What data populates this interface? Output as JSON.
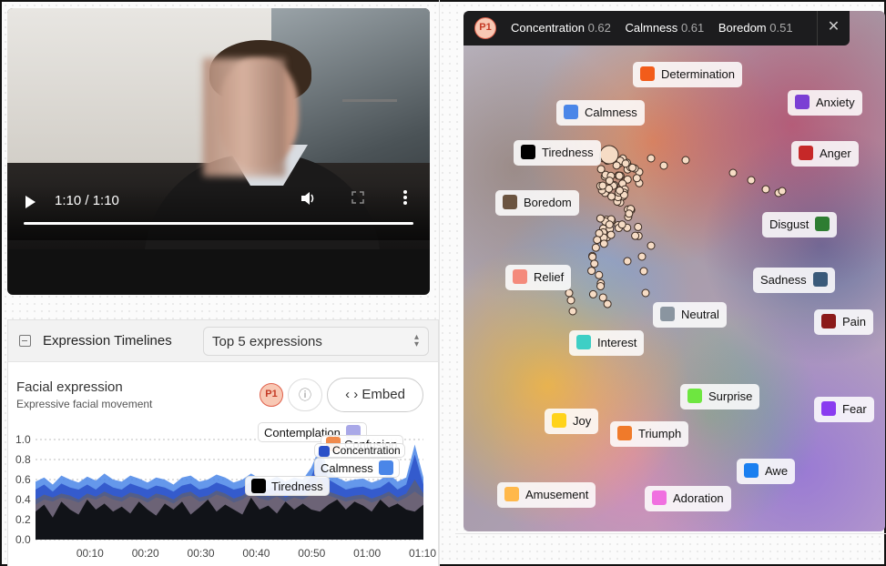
{
  "video": {
    "time": "1:10 / 1:10",
    "progress_fraction": 1.0,
    "icons": {
      "play": "play-icon",
      "volume": "volume-icon",
      "fullscreen": "fullscreen-icon",
      "more": "more-vertical-icon"
    }
  },
  "timelines": {
    "title": "Expression Timelines",
    "select_value": "Top 5 expressions",
    "section_title": "Facial expression",
    "section_subtitle": "Expressive facial movement",
    "participant": "P1",
    "embed_label": "Embed",
    "embed_icon": "‹ ›",
    "info_icon": "ⓘ"
  },
  "chart_data": {
    "type": "area",
    "x_ticks": [
      "00:10",
      "00:20",
      "00:30",
      "00:40",
      "00:50",
      "01:00",
      "01:10"
    ],
    "y_ticks": [
      "0.0",
      "0.2",
      "0.4",
      "0.6",
      "0.8",
      "1.0"
    ],
    "ylim": [
      0,
      1.0
    ],
    "xlim_seconds": [
      0,
      70
    ],
    "legend_position": "top-right-overlay",
    "series": [
      {
        "name": "Calmness",
        "color": "#4a86e8",
        "values": [
          0.58,
          0.62,
          0.55,
          0.64,
          0.6,
          0.57,
          0.63,
          0.59,
          0.66,
          0.6,
          0.58,
          0.64,
          0.61,
          0.57,
          0.62,
          0.6,
          0.55,
          0.62,
          0.64,
          0.58,
          0.6,
          0.65,
          0.62,
          0.57,
          0.6,
          0.66,
          0.61,
          0.59,
          0.63,
          0.58,
          0.62,
          0.6,
          0.72,
          0.93,
          0.68,
          0.62,
          0.58,
          0.6,
          0.61,
          0.57,
          0.6,
          0.66,
          0.58,
          0.62,
          0.95,
          0.62
        ]
      },
      {
        "name": "Concentration",
        "color": "#2b50c8",
        "values": [
          0.5,
          0.55,
          0.48,
          0.56,
          0.52,
          0.5,
          0.55,
          0.5,
          0.57,
          0.52,
          0.5,
          0.56,
          0.53,
          0.5,
          0.54,
          0.52,
          0.48,
          0.54,
          0.56,
          0.5,
          0.52,
          0.57,
          0.54,
          0.5,
          0.52,
          0.58,
          0.53,
          0.5,
          0.55,
          0.5,
          0.54,
          0.52,
          0.63,
          0.85,
          0.6,
          0.55,
          0.5,
          0.52,
          0.53,
          0.5,
          0.52,
          0.58,
          0.5,
          0.55,
          0.85,
          0.55
        ]
      },
      {
        "name": "Confusion",
        "color": "#e8834a",
        "values": [
          0.35,
          0.4,
          0.38,
          0.42,
          0.4,
          0.37,
          0.42,
          0.4,
          0.44,
          0.4,
          0.38,
          0.43,
          0.41,
          0.37,
          0.42,
          0.4,
          0.36,
          0.42,
          0.44,
          0.38,
          0.4,
          0.45,
          0.42,
          0.37,
          0.4,
          0.46,
          0.41,
          0.39,
          0.43,
          0.38,
          0.42,
          0.4,
          0.45,
          0.5,
          0.44,
          0.41,
          0.38,
          0.4,
          0.41,
          0.37,
          0.4,
          0.44,
          0.38,
          0.42,
          0.48,
          0.42
        ]
      },
      {
        "name": "Contemplation",
        "color": "#5a5f7a",
        "values": [
          0.4,
          0.45,
          0.42,
          0.46,
          0.44,
          0.4,
          0.46,
          0.43,
          0.48,
          0.44,
          0.42,
          0.47,
          0.45,
          0.41,
          0.46,
          0.44,
          0.4,
          0.46,
          0.48,
          0.42,
          0.44,
          0.49,
          0.46,
          0.41,
          0.44,
          0.5,
          0.45,
          0.43,
          0.47,
          0.42,
          0.46,
          0.44,
          0.5,
          0.62,
          0.48,
          0.45,
          0.42,
          0.44,
          0.45,
          0.41,
          0.44,
          0.48,
          0.42,
          0.46,
          0.6,
          0.46
        ]
      },
      {
        "name": "Tiredness",
        "color": "#111318",
        "values": [
          0.28,
          0.35,
          0.22,
          0.38,
          0.3,
          0.25,
          0.4,
          0.3,
          0.36,
          0.28,
          0.33,
          0.26,
          0.38,
          0.3,
          0.24,
          0.36,
          0.3,
          0.38,
          0.25,
          0.32,
          0.4,
          0.28,
          0.35,
          0.3,
          0.25,
          0.42,
          0.3,
          0.34,
          0.26,
          0.38,
          0.3,
          0.36,
          0.3,
          0.28,
          0.35,
          0.4,
          0.3,
          0.38,
          0.34,
          0.28,
          0.4,
          0.32,
          0.36,
          0.3,
          0.28,
          0.35
        ]
      }
    ]
  },
  "chart_legend": {
    "contemplation": {
      "label": "Contemplation",
      "color": "#a9a8e8"
    },
    "confusion": {
      "label": "Confusion",
      "color": "#f08a4b"
    },
    "concentration": {
      "label": "Concentration",
      "color": "#2b50c8"
    },
    "calmness": {
      "label": "Calmness",
      "color": "#4a86e8"
    },
    "tiredness": {
      "label": "Tiredness",
      "color": "#000000"
    }
  },
  "map": {
    "participant": "P1",
    "stats": [
      {
        "name": "Concentration",
        "value": "0.62"
      },
      {
        "name": "Calmness",
        "value": "0.61"
      },
      {
        "name": "Boredom",
        "value": "0.51"
      }
    ],
    "close_icon": "✕",
    "labels": {
      "determination": {
        "label": "Determination",
        "color": "#f25c1a"
      },
      "anxiety": {
        "label": "Anxiety",
        "color": "#7b3fd4"
      },
      "calmness": {
        "label": "Calmness",
        "color": "#4a86e8"
      },
      "anger": {
        "label": "Anger",
        "color": "#c62828"
      },
      "tiredness": {
        "label": "Tiredness",
        "color": "#000000"
      },
      "boredom": {
        "label": "Boredom",
        "color": "#6b5440"
      },
      "disgust": {
        "label": "Disgust",
        "color": "#2e7d32"
      },
      "relief": {
        "label": "Relief",
        "color": "#f48a7c"
      },
      "sadness": {
        "label": "Sadness",
        "color": "#3a5a7a"
      },
      "neutral": {
        "label": "Neutral",
        "color": "#8a95a0"
      },
      "pain": {
        "label": "Pain",
        "color": "#8b1a1a"
      },
      "interest": {
        "label": "Interest",
        "color": "#3ecfc5"
      },
      "surprise": {
        "label": "Surprise",
        "color": "#6ee640"
      },
      "fear": {
        "label": "Fear",
        "color": "#8a3cf0"
      },
      "joy": {
        "label": "Joy",
        "color": "#ffd31a"
      },
      "triumph": {
        "label": "Triumph",
        "color": "#f07a2a"
      },
      "awe": {
        "label": "Awe",
        "color": "#1a7ff0"
      },
      "amusement": {
        "label": "Amusement",
        "color": "#ffb84a"
      },
      "adoration": {
        "label": "Adoration",
        "color": "#f070e0"
      }
    }
  }
}
